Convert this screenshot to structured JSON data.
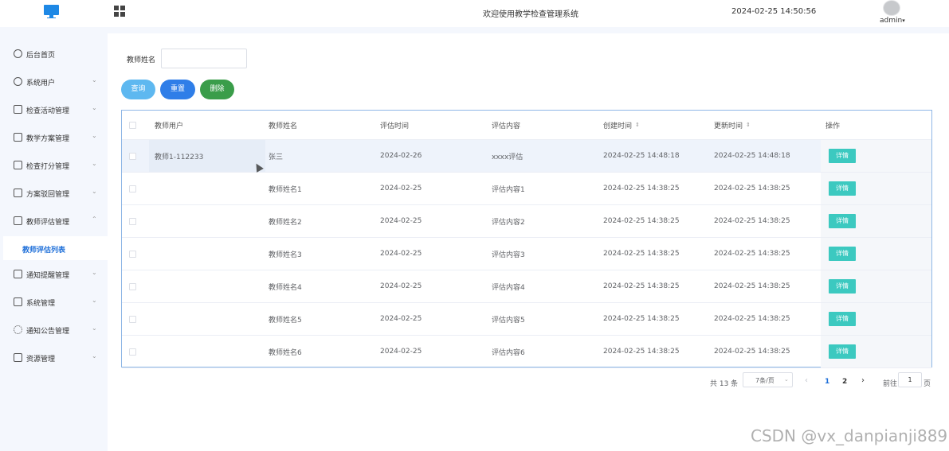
{
  "header": {
    "system_title": "欢迎使用教学检查管理系统",
    "datetime": "2024-02-25 14:50:56",
    "username": "admin",
    "username_caret": "▾",
    "logo_icon": "monitor-icon",
    "menu_toggle_icon": "grid-icon"
  },
  "sidebar": {
    "items": [
      {
        "label": "后台首页",
        "icon": "clock-icon"
      },
      {
        "label": "系统用户",
        "icon": "user-icon"
      },
      {
        "label": "检查活动管理",
        "icon": "card-icon"
      },
      {
        "label": "教学方案管理",
        "icon": "card-icon"
      },
      {
        "label": "检查打分管理",
        "icon": "card-icon"
      },
      {
        "label": "方案驳回管理",
        "icon": "card-icon"
      },
      {
        "label": "教师评估管理",
        "icon": "card-icon"
      },
      {
        "label": "通知提醒管理",
        "icon": "card-icon"
      },
      {
        "label": "系统管理",
        "icon": "folder-icon"
      },
      {
        "label": "通知公告管理",
        "icon": "spinner-icon"
      },
      {
        "label": "资源管理",
        "icon": "resource-icon"
      }
    ],
    "active_sub_item": "教师评估列表",
    "chevron_down": "⌄",
    "chevron_up": "⌃"
  },
  "filter": {
    "label": "教师姓名",
    "value": ""
  },
  "actions": {
    "search": "查询",
    "reset": "重置",
    "delete": "删除"
  },
  "table": {
    "headers": [
      "教师用户",
      "教师姓名",
      "评估时间",
      "评估内容",
      "创建时间",
      "更新时间",
      "操作"
    ],
    "sort_icon": "⇕",
    "detail_label": "详情",
    "rows": [
      {
        "user": "教师1-112233",
        "name": "张三",
        "eval_time": "2024-02-26",
        "content": "xxxx评估",
        "created": "2024-02-25 14:48:18",
        "updated": "2024-02-25 14:48:18"
      },
      {
        "user": "",
        "name": "教师姓名1",
        "eval_time": "2024-02-25",
        "content": "评估内容1",
        "created": "2024-02-25 14:38:25",
        "updated": "2024-02-25 14:38:25"
      },
      {
        "user": "",
        "name": "教师姓名2",
        "eval_time": "2024-02-25",
        "content": "评估内容2",
        "created": "2024-02-25 14:38:25",
        "updated": "2024-02-25 14:38:25"
      },
      {
        "user": "",
        "name": "教师姓名3",
        "eval_time": "2024-02-25",
        "content": "评估内容3",
        "created": "2024-02-25 14:38:25",
        "updated": "2024-02-25 14:38:25"
      },
      {
        "user": "",
        "name": "教师姓名4",
        "eval_time": "2024-02-25",
        "content": "评估内容4",
        "created": "2024-02-25 14:38:25",
        "updated": "2024-02-25 14:38:25"
      },
      {
        "user": "",
        "name": "教师姓名5",
        "eval_time": "2024-02-25",
        "content": "评估内容5",
        "created": "2024-02-25 14:38:25",
        "updated": "2024-02-25 14:38:25"
      },
      {
        "user": "",
        "name": "教师姓名6",
        "eval_time": "2024-02-25",
        "content": "评估内容6",
        "created": "2024-02-25 14:38:25",
        "updated": "2024-02-25 14:38:25"
      }
    ]
  },
  "pagination": {
    "total": "共 13 条",
    "page_size": "7条/页",
    "prev": "‹",
    "pages": [
      "1",
      "2"
    ],
    "next": "›",
    "goto_label": "前往",
    "goto_value": "1",
    "page_unit": "页"
  },
  "watermark": "CSDN @vx_danpianji889"
}
